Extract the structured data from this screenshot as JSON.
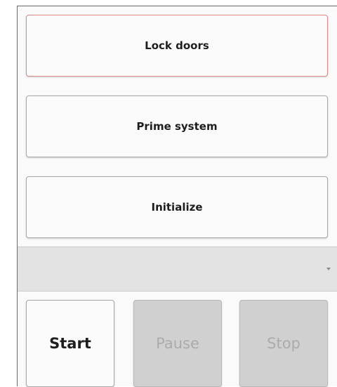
{
  "sequence_buttons": [
    {
      "label": "Lock doors",
      "selected": true
    },
    {
      "label": "Prime system",
      "selected": false
    },
    {
      "label": "Initialize",
      "selected": false
    }
  ],
  "dropdown": {
    "selected_value": "",
    "arrow_icon": "chevron-down-icon"
  },
  "controls": {
    "start": {
      "label": "Start",
      "enabled": true
    },
    "pause": {
      "label": "Pause",
      "enabled": false
    },
    "stop": {
      "label": "Stop",
      "enabled": false
    }
  },
  "colors": {
    "selected_border": "#e08a8a",
    "disabled_bg": "#d0d0d0",
    "disabled_text": "#ababab"
  }
}
